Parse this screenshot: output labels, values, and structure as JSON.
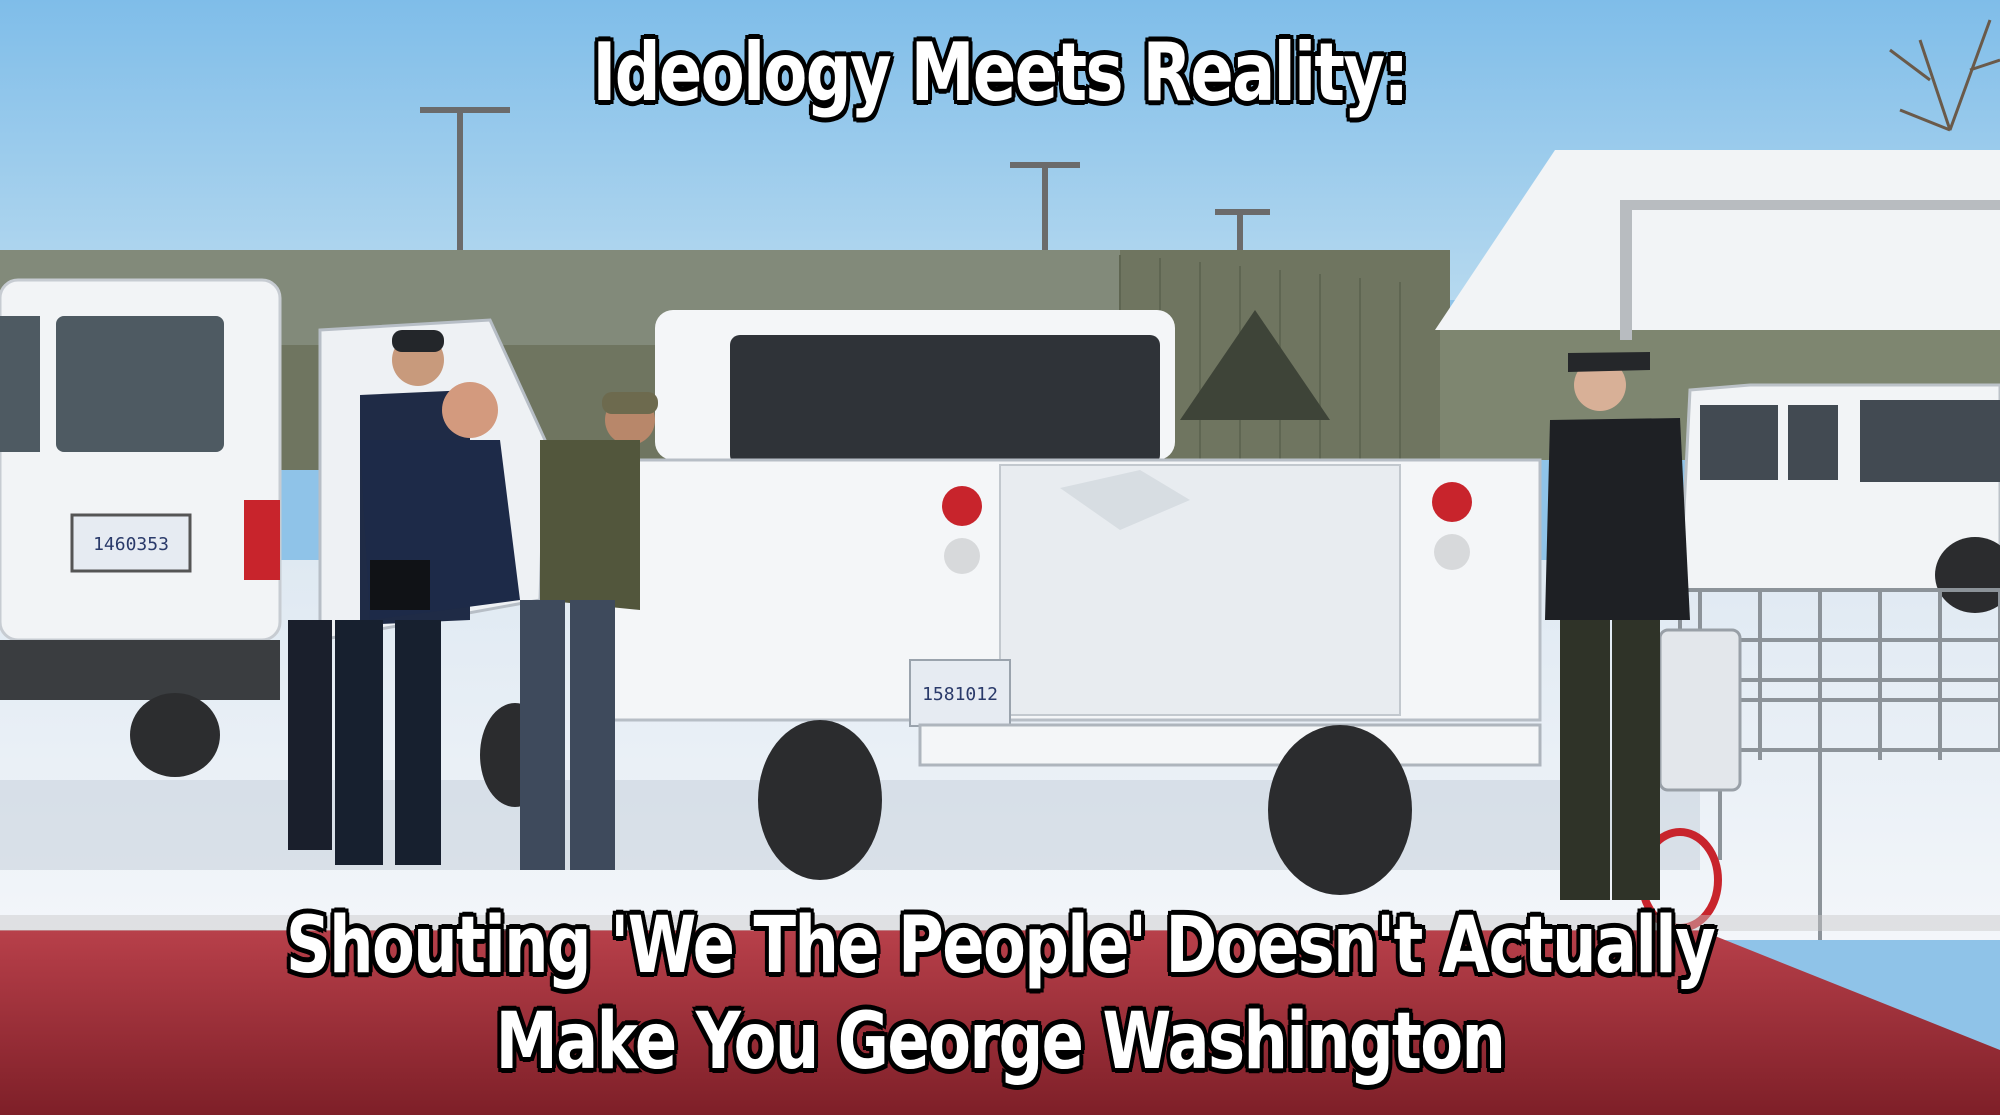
{
  "meme": {
    "top_caption": "Ideology Meets Reality:",
    "bottom_caption_line1": "Shouting 'We The People' Doesn't Actually",
    "bottom_caption_line2": "Make You George Washington"
  },
  "photo": {
    "van_plate": "1460353",
    "truck_plate": "1581012"
  },
  "colors": {
    "sky": "#8fc3e8",
    "snow": "#eef3f8",
    "truck_white": "#f4f6f8",
    "foreground_red": "#a8303a",
    "caption_fill": "#ffffff",
    "caption_outline": "#000000"
  }
}
